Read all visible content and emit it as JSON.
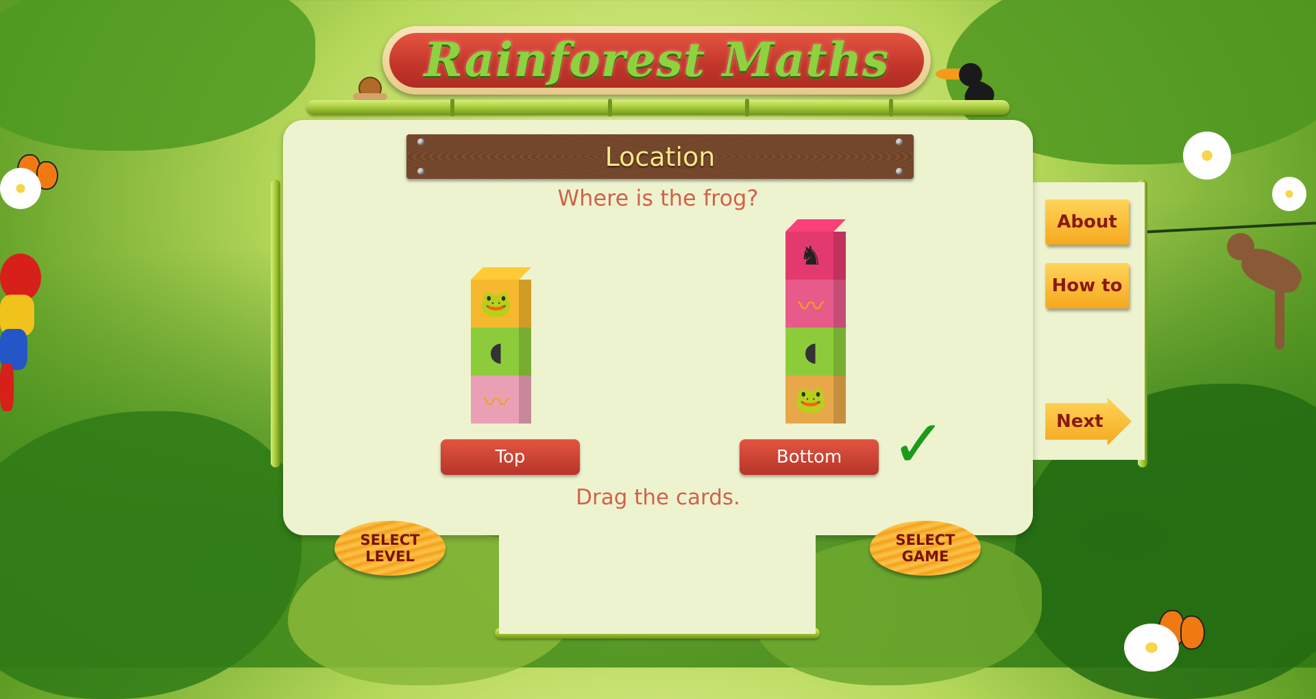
{
  "app": {
    "title": "Rainforest Maths"
  },
  "section": {
    "title": "Location"
  },
  "question": {
    "text": "Where is the frog?"
  },
  "instruction": {
    "text": "Drag the cards."
  },
  "towers": [
    {
      "blocks": [
        {
          "animal": "frog",
          "color": "#f5b82e"
        },
        {
          "animal": "tadpole",
          "color": "#8ccc3a"
        },
        {
          "animal": "snake",
          "color": "#eaa0b4"
        }
      ],
      "answer_label": "Top"
    },
    {
      "blocks": [
        {
          "animal": "cassowary",
          "color": "#e23a6e"
        },
        {
          "animal": "snake",
          "color": "#e85a8a"
        },
        {
          "animal": "tadpole",
          "color": "#8ccc3a"
        },
        {
          "animal": "frog",
          "color": "#e8a84a"
        }
      ],
      "answer_label": "Bottom"
    }
  ],
  "feedback": {
    "check_icon": "check-icon",
    "symbol": "✓",
    "color": "#1a9b1a"
  },
  "side_menu": {
    "about": "About",
    "how_to": "How to",
    "next": "Next"
  },
  "bottom_buttons": {
    "select_level": "SELECT LEVEL",
    "select_game": "SELECT GAME"
  }
}
